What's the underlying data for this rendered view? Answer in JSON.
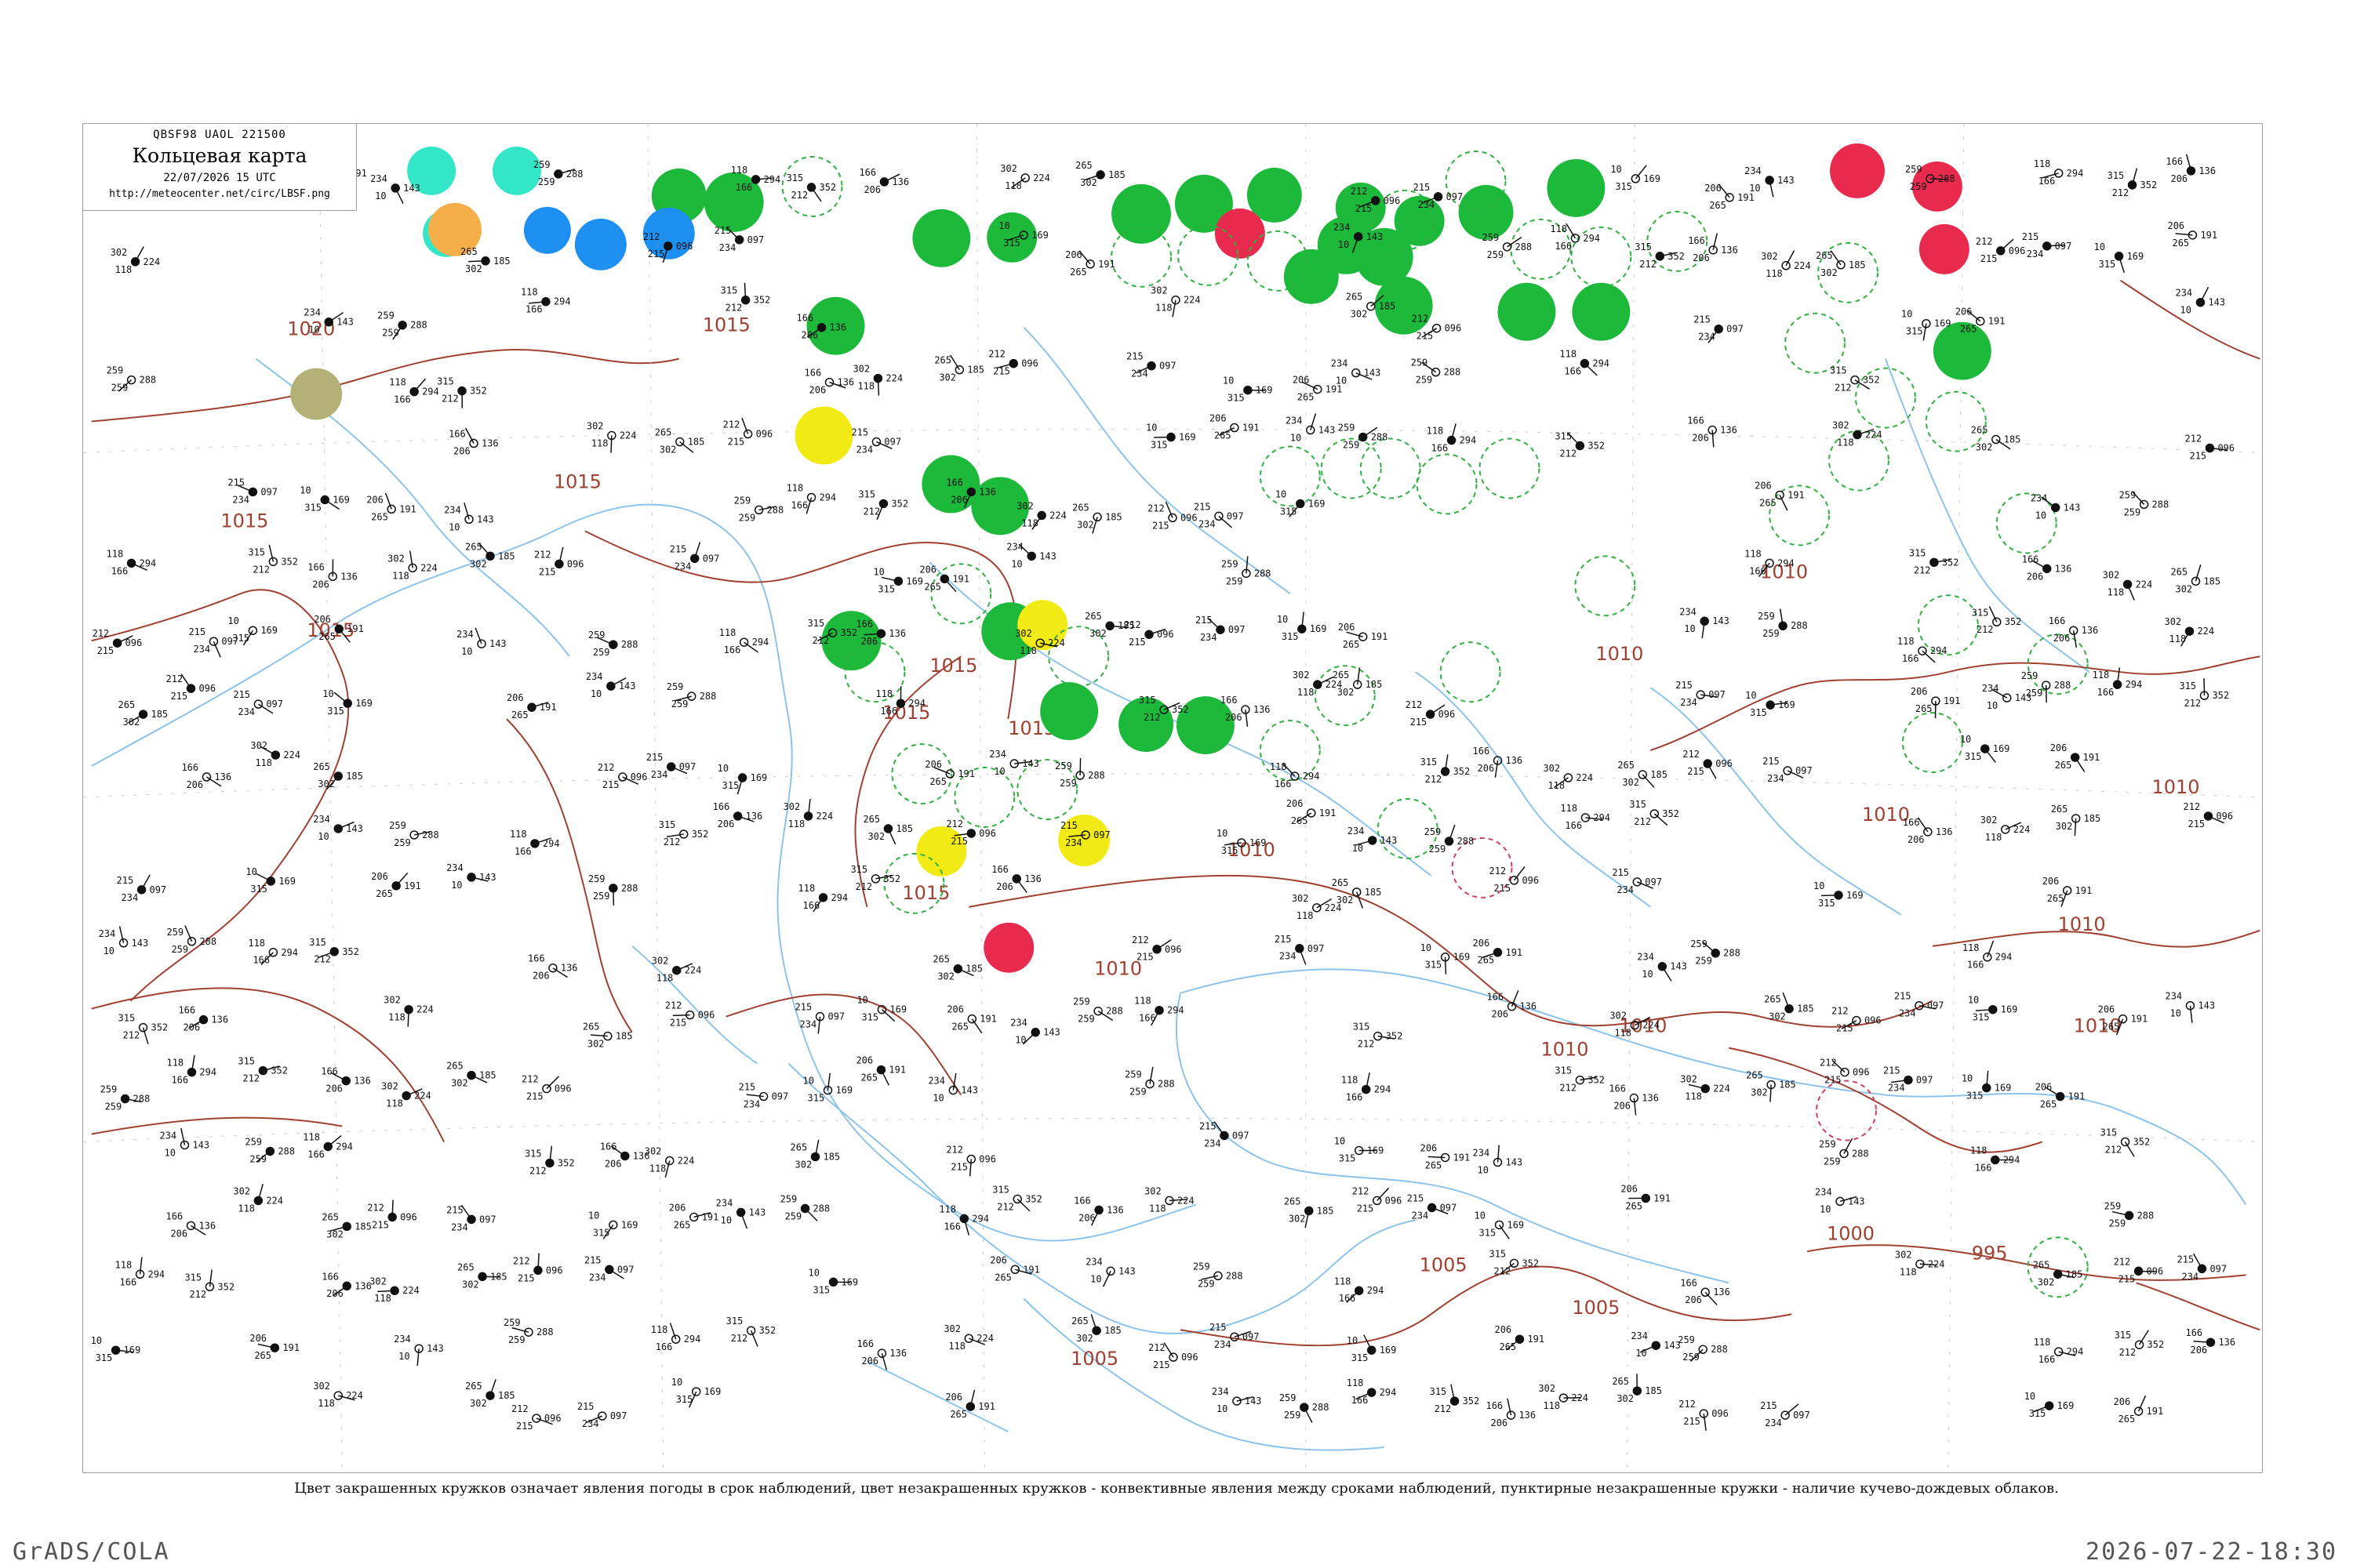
{
  "title": {
    "header": "QBSF98  UAOL  221500",
    "main": "Кольцевая карта",
    "time": "22/07/2026 15 UTC",
    "url": "http://meteocenter.net/circ/LBSF.png"
  },
  "caption": "Цвет закрашенных кружков означает явления погоды в срок наблюдений, цвет незакрашенных кружков - конвективные явления между сроками наблюдений, пунктирные незакрашенные кружки - наличие кучево-дождевых облаков.",
  "footer": {
    "left": "GrADS/COLA",
    "right": "2026-07-22-18:30"
  },
  "colors": {
    "isobar": "#a04030",
    "water": "#8cc3ec",
    "thunderstorm": "#1db93a",
    "rain_heavy": "#e82a4e",
    "fog": "#f2ea14",
    "drizzle": "#1c8ff0",
    "haze": "#b3b177",
    "snow_shower": "#33e6c8",
    "dust": "#f5ae4a",
    "cb_ring": "#30b040",
    "convective_ring": "#d04060"
  },
  "isobar_labels": [
    {
      "text": "1020"
    },
    {
      "text": "1015"
    },
    {
      "text": "1015"
    },
    {
      "text": "1015"
    },
    {
      "text": "1015"
    },
    {
      "text": "1015"
    },
    {
      "text": "1015"
    },
    {
      "text": "1015"
    },
    {
      "text": "1015"
    },
    {
      "text": "1010"
    },
    {
      "text": "1010"
    },
    {
      "text": "1010"
    },
    {
      "text": "1010"
    },
    {
      "text": "1010"
    },
    {
      "text": "1010"
    },
    {
      "text": "1010"
    },
    {
      "text": "1010"
    },
    {
      "text": "1010"
    },
    {
      "text": "1005"
    },
    {
      "text": "1005"
    },
    {
      "text": "1005"
    },
    {
      "text": "1000"
    },
    {
      "text": "995"
    },
    {
      "text": "1010"
    }
  ],
  "filled_circles": [
    {
      "phenomenon": "thunderstorm"
    },
    {
      "phenomenon": "thunderstorm"
    },
    {
      "phenomenon": "thunderstorm"
    },
    {
      "phenomenon": "thunderstorm"
    },
    {
      "phenomenon": "thunderstorm"
    },
    {
      "phenomenon": "thunderstorm"
    },
    {
      "phenomenon": "thunderstorm"
    },
    {
      "phenomenon": "thunderstorm"
    },
    {
      "phenomenon": "thunderstorm"
    },
    {
      "phenomenon": "thunderstorm"
    },
    {
      "phenomenon": "thunderstorm"
    },
    {
      "phenomenon": "thunderstorm"
    },
    {
      "phenomenon": "thunderstorm"
    },
    {
      "phenomenon": "thunderstorm"
    },
    {
      "phenomenon": "thunderstorm"
    },
    {
      "phenomenon": "thunderstorm"
    },
    {
      "phenomenon": "thunderstorm"
    },
    {
      "phenomenon": "thunderstorm"
    },
    {
      "phenomenon": "thunderstorm"
    },
    {
      "phenomenon": "thunderstorm"
    },
    {
      "phenomenon": "thunderstorm"
    },
    {
      "phenomenon": "thunderstorm"
    },
    {
      "phenomenon": "thunderstorm"
    },
    {
      "phenomenon": "thunderstorm"
    },
    {
      "phenomenon": "thunderstorm"
    },
    {
      "phenomenon": "thunderstorm"
    },
    {
      "phenomenon": "rain_heavy"
    },
    {
      "phenomenon": "rain_heavy"
    },
    {
      "phenomenon": "rain_heavy"
    },
    {
      "phenomenon": "rain_heavy"
    },
    {
      "phenomenon": "rain_heavy"
    },
    {
      "phenomenon": "fog"
    },
    {
      "phenomenon": "fog"
    },
    {
      "phenomenon": "fog"
    },
    {
      "phenomenon": "fog"
    },
    {
      "phenomenon": "drizzle"
    },
    {
      "phenomenon": "drizzle"
    },
    {
      "phenomenon": "drizzle"
    },
    {
      "phenomenon": "snow_shower"
    },
    {
      "phenomenon": "snow_shower"
    },
    {
      "phenomenon": "snow_shower"
    },
    {
      "phenomenon": "dust"
    },
    {
      "phenomenon": "haze"
    }
  ],
  "station_values": [
    "215",
    "097",
    "10",
    "169",
    "206",
    "191",
    "234",
    "143",
    "259",
    "288",
    "118",
    "294",
    "315",
    "352",
    "166",
    "136",
    "302",
    "224",
    "265",
    "185",
    "212",
    "096"
  ]
}
